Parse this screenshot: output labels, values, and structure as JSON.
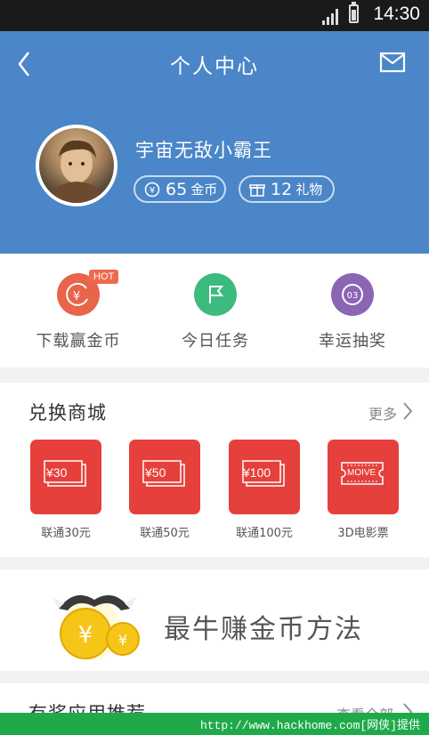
{
  "status_bar": {
    "time": "14:30"
  },
  "header": {
    "title": "个人中心",
    "username": "宇宙无敌小霸王",
    "coins": {
      "value": "65",
      "unit": "金币"
    },
    "gifts": {
      "value": "12",
      "unit": "礼物"
    }
  },
  "actions": [
    {
      "label": "下载赢金币",
      "badge": "HOT",
      "color": "#e8644a"
    },
    {
      "label": "今日任务",
      "color": "#3dbb7f"
    },
    {
      "label": "幸运抽奖",
      "color": "#8a66b5"
    }
  ],
  "shop": {
    "title": "兑换商城",
    "more": "更多",
    "items": [
      {
        "tile_text": "¥30",
        "caption": "联通30元"
      },
      {
        "tile_text": "¥50",
        "caption": "联通50元"
      },
      {
        "tile_text": "¥100",
        "caption": "联通100元"
      },
      {
        "tile_text": "MOIVE",
        "caption": "3D电影票"
      }
    ]
  },
  "promo": {
    "text": "最牛赚金币方法"
  },
  "recommend": {
    "title": "有奖应用推荐",
    "more": "查看全部"
  },
  "watermark": {
    "text": "http://www.hackhome.com[网侠]提供"
  },
  "colors": {
    "header_bg": "#4a86c8",
    "tile_red": "#e6403c",
    "coin_yellow": "#f5c518"
  }
}
